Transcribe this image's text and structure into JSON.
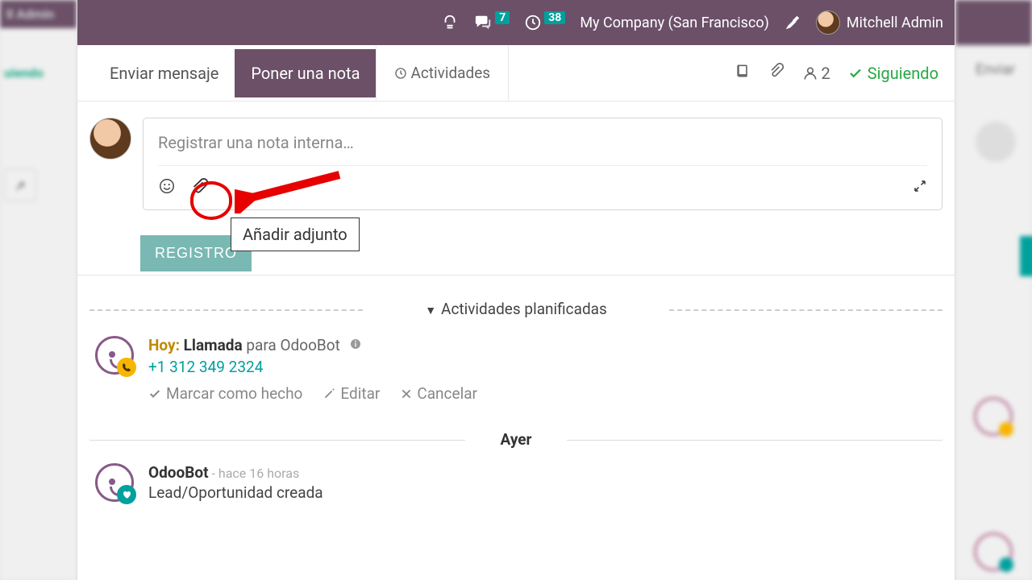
{
  "topbar": {
    "chat_badge": "7",
    "clock_badge": "38",
    "company": "My Company (San Francisco)",
    "user": "Mitchell Admin"
  },
  "tabs": {
    "send_message": "Enviar mensaje",
    "log_note": "Poner una nota",
    "activities": "Actividades"
  },
  "right_icons": {
    "followers_count": "2",
    "following_label": "Siguiendo"
  },
  "compose": {
    "placeholder": "Registrar una nota interna…",
    "submit": "REGISTRO",
    "tooltip": "Añadir adjunto"
  },
  "planned_section": "Actividades planificadas",
  "activity": {
    "today_label": "Hoy:",
    "type": "Llamada",
    "for_text": "para OdooBot",
    "phone": "+1 312 349 2324",
    "mark_done": "Marcar como hecho",
    "edit": "Editar",
    "cancel": "Cancelar"
  },
  "day_separator": "Ayer",
  "message": {
    "sender": "OdooBot",
    "time_prefix": "- hace 16 horas",
    "text": "Lead/Oportunidad creada"
  },
  "blur": {
    "left_top": "ll Admin",
    "left_mid": "uiendo",
    "right": "Enviar"
  }
}
